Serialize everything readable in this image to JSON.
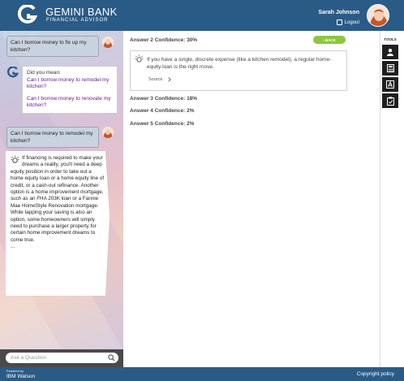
{
  "header": {
    "brand_title": "GEMINI BANK",
    "brand_subtitle": "FINANCIAL ADVISOR",
    "user_name": "Sarah Johnson",
    "logout_label": "Logout"
  },
  "chat": {
    "messages": [
      {
        "role": "user",
        "text": "Can I borrow money to fix up my kitchen?"
      },
      {
        "role": "bot",
        "intro": "Did you mean:",
        "suggestions": [
          "Can I borrow money to remodel my kitchen?",
          "Can I borrow money to renovate my kitchen?"
        ]
      },
      {
        "role": "user",
        "text": "Can I borrow money to remodel my kitchen?"
      },
      {
        "role": "bot",
        "text": "If financing is required to make your dreams a reality, you'll need a deep equity position in order to take out a home equity loan or a home equity line of credit, or a cash-out refinance. Another option is a home improvement mortgage, such as an FHA 203K loan or a Fannie Mae HomeStyle Renovation mortgage. While tapping your saving is also an option, some homeowners will simply need to purchase a larger property for certain home improvement dreams to come true.",
        "ellipsis": "..."
      }
    ],
    "ask_placeholder": "Ask a Question"
  },
  "main": {
    "back_label": "‹ BACK",
    "answers": [
      {
        "label": "Answer 2 Confidence: 30%",
        "expanded": true,
        "text": "If you have a single, discrete expense (like a kitchen remodel), a regular home-equity loan is the right move.",
        "source_label": "Source"
      },
      {
        "label": "Answer 3 Confidence: 18%"
      },
      {
        "label": "Answer 4 Confidence: 2%"
      },
      {
        "label": "Answer 5 Confidence: 2%"
      }
    ]
  },
  "tools": {
    "label": "TOOLS",
    "items": [
      "user-icon",
      "calculator-icon",
      "font-icon",
      "clipboard-icon"
    ]
  },
  "footer": {
    "powered_by": "Powered by",
    "ibm_watson": "IBM Watson",
    "copyright": "Copyright policy"
  },
  "colors": {
    "header_bg": "#2a5b86",
    "back_button": "#8cc63f",
    "link_purple": "#6a1c8a",
    "tool_bg": "#1f1f1f"
  }
}
